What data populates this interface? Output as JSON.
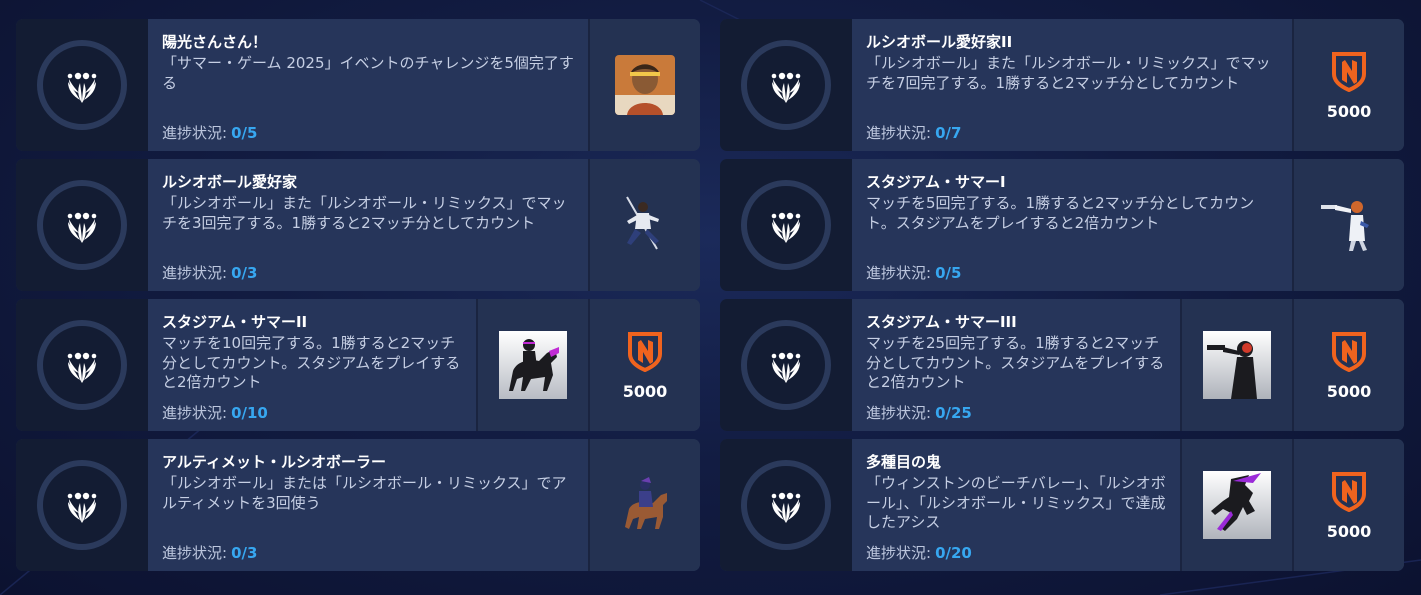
{
  "progress_label": "進捗状況:",
  "colors": {
    "accent_blue": "#37a7f0",
    "shield_orange": "#f0631e",
    "card_bg": "#243252",
    "icon_panel_bg": "#131c33"
  },
  "challenges": [
    {
      "title": "陽光さんさん！",
      "description": "「サマー・ゲーム 2025」イベントのチャレンジを5個完了する",
      "progress": "0/5",
      "reward_icon": "summer-hero-portrait-icon",
      "points": ""
    },
    {
      "title": "ルシオボール愛好家II",
      "description": "「ルシオボール」また「ルシオボール・リミックス」でマッチを7回完了する。1勝すると2マッチ分としてカウント",
      "progress": "0/7",
      "reward_icon": "competitive-shield-icon",
      "points": "5000"
    },
    {
      "title": "ルシオボール愛好家",
      "description": "「ルシオボール」また「ルシオボール・リミックス」でマッチを3回完了する。1勝すると2マッチ分としてカウント",
      "progress": "0/3",
      "reward_icon": "spear-fighter-spray-icon",
      "points": ""
    },
    {
      "title": "スタジアム・サマーI",
      "description": "マッチを5回完了する。1勝すると2マッチ分としてカウント。スタジアムをプレイすると2倍カウント",
      "progress": "0/5",
      "reward_icon": "gunslinger-spray-icon",
      "points": ""
    },
    {
      "title": "スタジアム・サマーII",
      "description": "マッチを10回完了する。1勝すると2マッチ分としてカウント。スタジアムをプレイすると2倍カウント",
      "progress": "0/10",
      "reward_icon": "horse-rider-silhouette-icon",
      "points": "5000"
    },
    {
      "title": "スタジアム・サマーIII",
      "description": "マッチを25回完了する。1勝すると2マッチ分としてカウント。スタジアムをプレイすると2倍カウント",
      "progress": "0/25",
      "reward_icon": "gunner-silhouette-icon",
      "points": "5000"
    },
    {
      "title": "アルティメット・ルシオボーラー",
      "description": "「ルシオボール」または「ルシオボール・リミックス」でアルティメットを3回使う",
      "progress": "0/3",
      "reward_icon": "horse-rider-spray-icon",
      "points": ""
    },
    {
      "title": "多種目の鬼",
      "description": "「ウィンストンのビーチバレー」、「ルシオボール」、「ルシオボール・リミックス」で達成したアシス",
      "progress": "0/20",
      "reward_icon": "ninja-silhouette-icon",
      "points": "5000"
    }
  ]
}
